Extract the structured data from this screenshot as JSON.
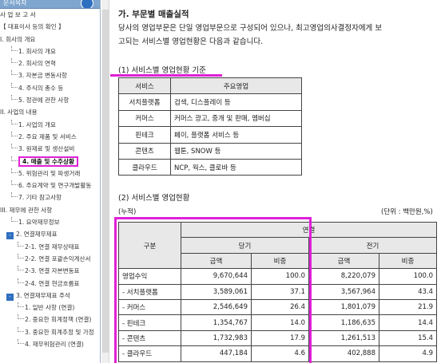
{
  "sidebar": {
    "header_label": "문서목차",
    "items": [
      {
        "label": "사 업 보 고 서",
        "level": 0,
        "marker": "none"
      },
      {
        "label": "【 대표이사 등의 확인 】",
        "level": 0,
        "marker": "none"
      },
      {
        "label": "I. 회사의 개요",
        "level": 0,
        "marker": "none"
      },
      {
        "label": "1. 회사의 개요",
        "level": 2,
        "marker": "line"
      },
      {
        "label": "2. 회사의 연혁",
        "level": 2,
        "marker": "line"
      },
      {
        "label": "3. 자본금 변동사항",
        "level": 2,
        "marker": "line"
      },
      {
        "label": "4. 주식의 총수 등",
        "level": 2,
        "marker": "line"
      },
      {
        "label": "5. 정관에 관한 사항",
        "level": 2,
        "marker": "line"
      },
      {
        "label": "II. 사업의 내용",
        "level": 0,
        "marker": "none"
      },
      {
        "label": "1. 사업의 개요",
        "level": 2,
        "marker": "line"
      },
      {
        "label": "2. 주요 제품 및 서비스",
        "level": 2,
        "marker": "line"
      },
      {
        "label": "3. 원재료 및 생산설비",
        "level": 2,
        "marker": "line"
      },
      {
        "label": "4. 매출 및 수주상황",
        "level": 2,
        "marker": "line",
        "active": true
      },
      {
        "label": "5. 위험관리 및 파생거래",
        "level": 2,
        "marker": "line"
      },
      {
        "label": "6. 주요계약 및 연구개발활동",
        "level": 2,
        "marker": "line"
      },
      {
        "label": "7. 기타 참고사항",
        "level": 2,
        "marker": "line"
      },
      {
        "label": "III. 재무에 관한 사항",
        "level": 0,
        "marker": "none"
      },
      {
        "label": "1. 요약재무정보",
        "level": 2,
        "marker": "line"
      },
      {
        "label": "2. 연결재무제표",
        "level": 1,
        "marker": "box"
      },
      {
        "label": "2-1. 연결 재무상태표",
        "level": 3,
        "marker": "line"
      },
      {
        "label": "2-2. 연결 포괄손익계산서",
        "level": 3,
        "marker": "line"
      },
      {
        "label": "2-3. 연결 자본변동표",
        "level": 3,
        "marker": "line"
      },
      {
        "label": "2-4. 연결 현금흐름표",
        "level": 3,
        "marker": "line"
      },
      {
        "label": "3. 연결재무제표 주석",
        "level": 1,
        "marker": "box"
      },
      {
        "label": "1. 일반 사항 (연결)",
        "level": 3,
        "marker": "line"
      },
      {
        "label": "2. 중요한 회계정책 (연결)",
        "level": 3,
        "marker": "line"
      },
      {
        "label": "3. 중요한 회계추정 및 가정",
        "level": 3,
        "marker": "line"
      },
      {
        "label": "4. 재무위험관리 (연결)",
        "level": 3,
        "marker": "line"
      }
    ]
  },
  "document": {
    "section_title": "가. 부문별 매출실적",
    "paragraph_lines": [
      "당사의 영업부문은 단일 영업부문으로 구성되어 있으나, 최고영업의사결정자에게 보",
      "고되는 서비스별 영업현황은 다음과 같습니다."
    ],
    "sub1": "(1) 서비스별 영업현황 기준",
    "service_table": {
      "headers": [
        "서비스",
        "주요영업"
      ],
      "rows": [
        [
          "서치플랫폼",
          "검색, 디스플레이 등"
        ],
        [
          "커머스",
          "커머스 광고, 중개 및 판매, 멤버십"
        ],
        [
          "핀테크",
          "페이, 플랫폼 서비스 등"
        ],
        [
          "콘텐츠",
          "웹툰, SNOW 등"
        ],
        [
          "클라우드",
          "NCP, 웍스, 클로바 등"
        ]
      ]
    },
    "sub2": "(2) 서비스별 영업현황",
    "cumulative_label": "(누적)",
    "unit_label": "(단위 : 백만원,%)",
    "perf_table": {
      "group_header": "연결",
      "row_header": "구분",
      "period_current": "당기",
      "period_prior": "전기",
      "col_amount": "금액",
      "col_ratio": "비중",
      "rows": [
        {
          "label": "영업수익",
          "cur_amount": "9,670,644",
          "cur_ratio": "100.0",
          "prev_amount": "8,220,079",
          "prev_ratio": "100.0"
        },
        {
          "label": "- 서치플랫폼",
          "cur_amount": "3,589,061",
          "cur_ratio": "37.1",
          "prev_amount": "3,567,964",
          "prev_ratio": "43.4"
        },
        {
          "label": "- 커머스",
          "cur_amount": "2,546,649",
          "cur_ratio": "26.4",
          "prev_amount": "1,801,079",
          "prev_ratio": "21.9"
        },
        {
          "label": "- 핀테크",
          "cur_amount": "1,354,767",
          "cur_ratio": "14.0",
          "prev_amount": "1,186,635",
          "prev_ratio": "14.4"
        },
        {
          "label": "- 콘텐츠",
          "cur_amount": "1,732,983",
          "cur_ratio": "17.9",
          "prev_amount": "1,261,513",
          "prev_ratio": "15.4"
        },
        {
          "label": "- 클라우드",
          "cur_amount": "447,184",
          "cur_ratio": "4.6",
          "prev_amount": "402,888",
          "prev_ratio": "4.9"
        }
      ]
    }
  },
  "colors": {
    "highlight": "#e020d8",
    "tree_box": "#2f6fc0",
    "header_bg": "#e8e8e8"
  }
}
